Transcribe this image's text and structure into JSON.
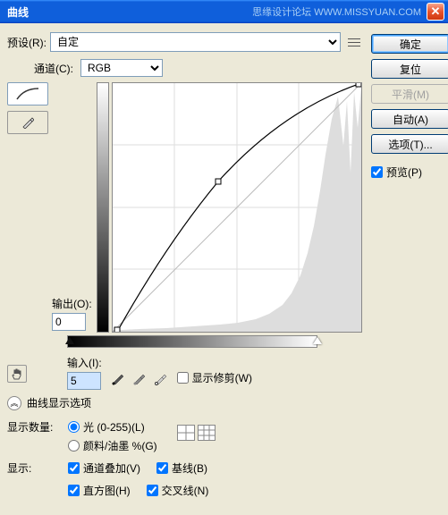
{
  "title": "曲线",
  "watermark": "思缘设计论坛 WWW.MISSYUAN.COM",
  "preset": {
    "label": "预设(R):",
    "value": "自定"
  },
  "channel": {
    "label": "通道(C):",
    "value": "RGB"
  },
  "output": {
    "label": "输出(O):",
    "value": "0"
  },
  "input": {
    "label": "输入(I):",
    "value": "5"
  },
  "show_clip": "显示修剪(W)",
  "display_options_title": "曲线显示选项",
  "show_amount": {
    "label": "显示数量:",
    "light": "光 (0-255)(L)",
    "pigment": "颜料/油墨 %(G)"
  },
  "show": {
    "label": "显示:",
    "overlay": "通道叠加(V)",
    "baseline": "基线(B)",
    "histogram": "直方图(H)",
    "intersection": "交叉线(N)"
  },
  "buttons": {
    "ok": "确定",
    "cancel": "复位",
    "smooth": "平滑(M)",
    "auto": "自动(A)",
    "options": "选项(T)..."
  },
  "preview": "预览(P)",
  "chart_data": {
    "type": "curve",
    "title": "曲线",
    "xlabel": "输入",
    "ylabel": "输出",
    "xlim": [
      0,
      255
    ],
    "ylim": [
      0,
      255
    ],
    "curve_points": [
      [
        5,
        0
      ],
      [
        108,
        155
      ],
      [
        255,
        255
      ]
    ],
    "histogram_peaks": "right-heavy distribution concentrated 180-255"
  }
}
